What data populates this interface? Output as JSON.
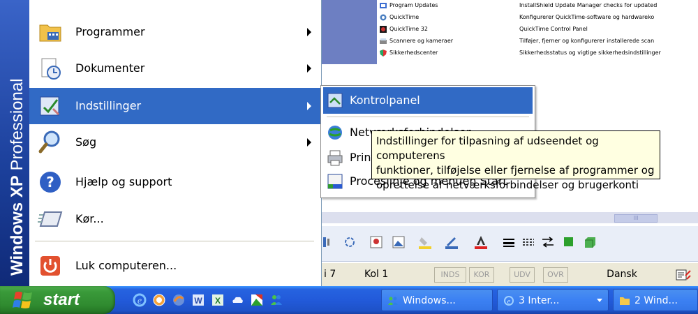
{
  "background_window": {
    "control_panel_rows": [
      {
        "name": "Program Updates",
        "description": "InstallShield Update Manager checks for updated"
      },
      {
        "name": "QuickTime",
        "description": "Konfigurerer QuickTime-software og hardwareko"
      },
      {
        "name": "QuickTime 32",
        "description": "QuickTime Control Panel"
      },
      {
        "name": "Scannere og kameraer",
        "description": "Tilføjer, fjerner og konfigurerer installerede scan"
      },
      {
        "name": "Sikkerhedscenter",
        "description": "Sikkerhedsstatus og vigtige sikkerhedsindstillinger"
      }
    ],
    "scroll_thumb_glyph": "III",
    "status_bar": {
      "line": "i 7",
      "column": "Kol 1",
      "indicators": [
        "INDS",
        "KOR",
        "UDV",
        "OVR"
      ],
      "language": "Dansk"
    }
  },
  "start_menu": {
    "sidebar_brand_bold": "Windows XP",
    "sidebar_brand_rest": " Professional",
    "items": [
      {
        "label": "Programmer",
        "icon": "programs-folder-icon",
        "has_submenu": true
      },
      {
        "label": "Dokumenter",
        "icon": "documents-icon",
        "has_submenu": true
      },
      {
        "label": "Indstillinger",
        "icon": "settings-icon",
        "has_submenu": true,
        "highlighted": true
      },
      {
        "label": "Søg",
        "icon": "search-icon",
        "has_submenu": true
      },
      {
        "label": "Hjælp og support",
        "icon": "help-icon",
        "has_submenu": false
      },
      {
        "label": "Kør...",
        "icon": "run-icon",
        "has_submenu": false
      },
      {
        "label": "Luk computeren...",
        "icon": "shutdown-icon",
        "has_submenu": false
      }
    ]
  },
  "submenu": {
    "items": [
      {
        "label": "Kontrolpanel",
        "icon": "control-panel-icon",
        "highlighted": true
      },
      {
        "label": "Netværksforbindelser",
        "icon": "network-icon"
      },
      {
        "label": "Printere og faxenheder",
        "icon": "printer-icon"
      },
      {
        "label": "Proceslinje og menuen Start",
        "icon": "taskbar-icon"
      }
    ]
  },
  "tooltip": {
    "lines": [
      "Indstillinger for tilpasning af udseendet og computerens",
      "funktioner, tilføjelse eller fjernelse af programmer og",
      "oprettelse af netværksforbindelser og brugerkonti"
    ]
  },
  "taskbar": {
    "start_label": "start",
    "quick_launch": [
      "ie-icon",
      "clock-icon",
      "firefox-icon",
      "word-icon",
      "excel-icon",
      "cloud-icon",
      "image-icon",
      "msn-icon"
    ],
    "tasks": [
      {
        "label": "Windows...",
        "icon": "msn-icon"
      },
      {
        "label": "3 Inter...",
        "icon": "ie-icon",
        "has_dropdown": true
      },
      {
        "label": "2 Wind...",
        "icon": "folder-icon"
      }
    ]
  },
  "colors": {
    "highlight": "#316ac5",
    "taskbar_blue": "#225ada",
    "start_green": "#3a9a3a",
    "tooltip_bg": "#ffffe1"
  }
}
